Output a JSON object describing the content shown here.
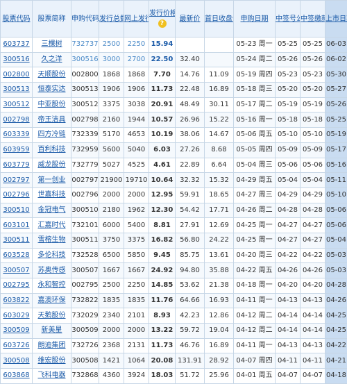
{
  "headers": {
    "code": "股票代码",
    "name": "股票简称",
    "apply_code": "申购代码",
    "issue_total": "发行总数(万股)",
    "online": "网上发行(万股)",
    "price": "发行价格",
    "latest": "最新价",
    "first_close": "首日收盘价",
    "apply_date": "申购日期",
    "lottery_date": "中签号公布日",
    "pay_date": "中签缴款日期",
    "list_date": "上市日期"
  },
  "rows": [
    {
      "code": "603737",
      "name": "三棵树",
      "apply_code": "732737",
      "issue": "2500",
      "online": "2250",
      "price": "15.94",
      "latest": "",
      "first": "",
      "apply": "05-23 周一",
      "lottery": "05-25",
      "pay": "05-25",
      "list": "06-03"
    },
    {
      "code": "300516",
      "name": "久之洋",
      "apply_code": "300516",
      "issue": "3000",
      "online": "2700",
      "price": "22.50",
      "latest": "32.40",
      "first": "",
      "apply": "05-24 周二",
      "lottery": "05-26",
      "pay": "05-26",
      "list": "06-02"
    },
    {
      "code": "002800",
      "name": "天顺股份",
      "apply_code": "002800",
      "issue": "1868",
      "online": "1868",
      "price": "7.70",
      "latest": "14.76",
      "first": "11.09",
      "apply": "05-19 周四",
      "lottery": "05-23",
      "pay": "05-23",
      "list": "05-30"
    },
    {
      "code": "300513",
      "name": "恒泰实达",
      "apply_code": "300513",
      "issue": "1906",
      "online": "1906",
      "price": "11.73",
      "latest": "22.48",
      "first": "16.89",
      "apply": "05-18 周三",
      "lottery": "05-20",
      "pay": "05-20",
      "list": "05-27"
    },
    {
      "code": "300512",
      "name": "中亚股份",
      "apply_code": "300512",
      "issue": "3375",
      "online": "3038",
      "price": "20.91",
      "latest": "48.49",
      "first": "30.11",
      "apply": "05-17 周二",
      "lottery": "05-19",
      "pay": "05-19",
      "list": "05-26"
    },
    {
      "code": "002798",
      "name": "帝王洁具",
      "apply_code": "002798",
      "issue": "2160",
      "online": "1944",
      "price": "10.57",
      "latest": "26.96",
      "first": "15.22",
      "apply": "05-16 周一",
      "lottery": "05-18",
      "pay": "05-18",
      "list": "05-25"
    },
    {
      "code": "603339",
      "name": "四方冷链",
      "apply_code": "732339",
      "issue": "5170",
      "online": "4653",
      "price": "10.19",
      "latest": "38.06",
      "first": "14.67",
      "apply": "05-06 周五",
      "lottery": "05-10",
      "pay": "05-10",
      "list": "05-19"
    },
    {
      "code": "603959",
      "name": "百利科技",
      "apply_code": "732959",
      "issue": "5600",
      "online": "5040",
      "price": "6.03",
      "latest": "27.26",
      "first": "8.68",
      "apply": "05-05 周四",
      "lottery": "05-09",
      "pay": "05-09",
      "list": "05-17"
    },
    {
      "code": "603779",
      "name": "威龙股份",
      "apply_code": "732779",
      "issue": "5027",
      "online": "4525",
      "price": "4.61",
      "latest": "22.89",
      "first": "6.64",
      "apply": "05-04 周三",
      "lottery": "05-06",
      "pay": "05-06",
      "list": "05-16"
    },
    {
      "code": "002797",
      "name": "第一创业",
      "apply_code": "002797",
      "issue": "21900",
      "online": "19710",
      "price": "10.64",
      "latest": "32.32",
      "first": "15.32",
      "apply": "04-29 周五",
      "lottery": "05-04",
      "pay": "05-04",
      "list": "05-11"
    },
    {
      "code": "002796",
      "name": "世嘉科技",
      "apply_code": "002796",
      "issue": "2000",
      "online": "2000",
      "price": "12.95",
      "latest": "59.91",
      "first": "18.65",
      "apply": "04-27 周三",
      "lottery": "04-29",
      "pay": "04-29",
      "list": "05-10"
    },
    {
      "code": "300510",
      "name": "金冠电气",
      "apply_code": "300510",
      "issue": "2180",
      "online": "1962",
      "price": "12.30",
      "latest": "54.42",
      "first": "17.71",
      "apply": "04-26 周二",
      "lottery": "04-28",
      "pay": "04-28",
      "list": "05-06"
    },
    {
      "code": "603101",
      "name": "汇嘉时代",
      "apply_code": "732101",
      "issue": "6000",
      "online": "5400",
      "price": "8.81",
      "latest": "27.91",
      "first": "12.69",
      "apply": "04-25 周一",
      "lottery": "04-27",
      "pay": "04-27",
      "list": "05-06"
    },
    {
      "code": "300511",
      "name": "雪榕生物",
      "apply_code": "300511",
      "issue": "3750",
      "online": "3375",
      "price": "16.82",
      "latest": "56.80",
      "first": "24.22",
      "apply": "04-25 周一",
      "lottery": "04-27",
      "pay": "04-27",
      "list": "05-04"
    },
    {
      "code": "603528",
      "name": "多伦科技",
      "apply_code": "732528",
      "issue": "6500",
      "online": "5850",
      "price": "9.45",
      "latest": "85.75",
      "first": "13.61",
      "apply": "04-20 周三",
      "lottery": "04-22",
      "pay": "04-22",
      "list": "05-03"
    },
    {
      "code": "300507",
      "name": "苏奥传感",
      "apply_code": "300507",
      "issue": "1667",
      "online": "1667",
      "price": "24.92",
      "latest": "94.80",
      "first": "35.88",
      "apply": "04-22 周五",
      "lottery": "04-26",
      "pay": "04-26",
      "list": "05-03"
    },
    {
      "code": "002795",
      "name": "永和智控",
      "apply_code": "002795",
      "issue": "2500",
      "online": "2250",
      "price": "14.85",
      "latest": "53.62",
      "first": "21.38",
      "apply": "04-18 周一",
      "lottery": "04-20",
      "pay": "04-20",
      "list": "04-28"
    },
    {
      "code": "603822",
      "name": "嘉澳环保",
      "apply_code": "732822",
      "issue": "1835",
      "online": "1835",
      "price": "11.76",
      "latest": "64.66",
      "first": "16.93",
      "apply": "04-11 周一",
      "lottery": "04-13",
      "pay": "04-13",
      "list": "04-26"
    },
    {
      "code": "603029",
      "name": "天鹅股份",
      "apply_code": "732029",
      "issue": "2340",
      "online": "2101",
      "price": "8.93",
      "latest": "42.23",
      "first": "12.86",
      "apply": "04-12 周二",
      "lottery": "04-14",
      "pay": "04-14",
      "list": "04-25"
    },
    {
      "code": "300509",
      "name": "新美星",
      "apply_code": "300509",
      "issue": "2000",
      "online": "2000",
      "price": "13.22",
      "latest": "59.72",
      "first": "19.04",
      "apply": "04-12 周二",
      "lottery": "04-14",
      "pay": "04-14",
      "list": "04-25"
    },
    {
      "code": "603726",
      "name": "朗迪集团",
      "apply_code": "732726",
      "issue": "2368",
      "online": "2131",
      "price": "11.73",
      "latest": "46.76",
      "first": "16.89",
      "apply": "04-11 周一",
      "lottery": "04-13",
      "pay": "04-13",
      "list": "04-22"
    },
    {
      "code": "300508",
      "name": "维宏股份",
      "apply_code": "300508",
      "issue": "1421",
      "online": "1064",
      "price": "20.08",
      "latest": "131.91",
      "first": "28.92",
      "apply": "04-07 周四",
      "lottery": "04-11",
      "pay": "04-11",
      "list": "04-21"
    },
    {
      "code": "603868",
      "name": "飞科电器",
      "apply_code": "732868",
      "issue": "4360",
      "online": "3924",
      "price": "18.03",
      "latest": "51.72",
      "first": "25.96",
      "apply": "04-01 周五",
      "lottery": "04-07",
      "pay": "04-07",
      "list": "04-18"
    }
  ],
  "icons": {
    "price_help": "question-icon"
  }
}
